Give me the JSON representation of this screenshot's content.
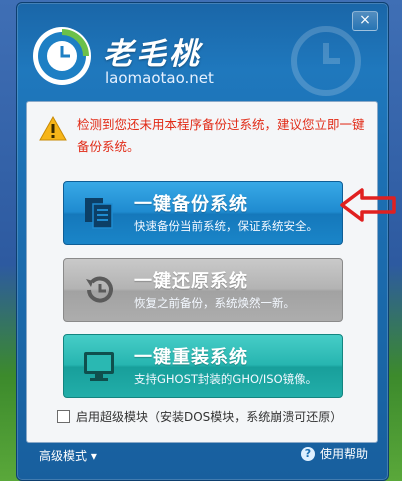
{
  "brand": {
    "name": "老毛桃",
    "domain": "laomaotao.net"
  },
  "window": {
    "close_label": "×"
  },
  "warning": {
    "text": "检测到您还未用本程序备份过系统，建议您立即一键备份系统。"
  },
  "buttons": [
    {
      "title": "一键备份系统",
      "subtitle": "快速备份当前系统，保证系统安全。",
      "icon": "document-copy-icon"
    },
    {
      "title": "一键还原系统",
      "subtitle": "恢复之前备份，系统焕然一新。",
      "icon": "restore-clock-icon"
    },
    {
      "title": "一键重装系统",
      "subtitle": "支持GHOST封装的GHO/ISO镜像。",
      "icon": "monitor-icon"
    }
  ],
  "advanced_option": {
    "label": "启用超级模块（安装DOS模块，系统崩溃可还原）",
    "checked": false
  },
  "footer": {
    "mode_label": "高级模式 ▾",
    "help_label": "使用帮助",
    "help_glyph": "?"
  },
  "colors": {
    "warning_red": "#e12a16",
    "window_blue": "#1c6fb2",
    "backup_blue": "#1f8bd0",
    "restore_gray": "#b3b3b3",
    "reinstall_teal": "#27b5b0",
    "annotation_arrow": "#e02020"
  }
}
